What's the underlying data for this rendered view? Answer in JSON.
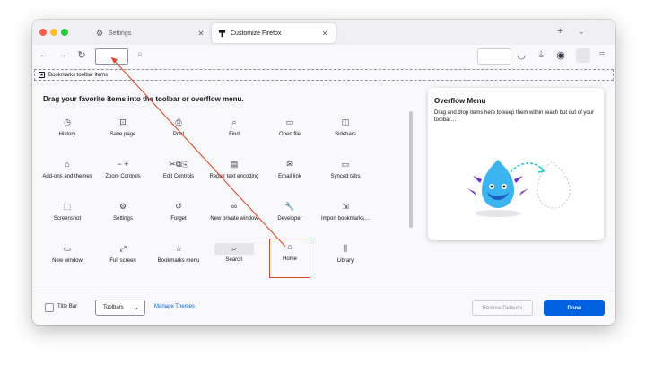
{
  "tabs": [
    {
      "title": "Settings",
      "icon": "gear-icon"
    },
    {
      "title": "Customize Firefox",
      "icon": "customize-icon"
    }
  ],
  "bookmarks_toolbar": {
    "label": "Bookmarks toolbar items"
  },
  "palette": {
    "title": "Drag your favorite items into the toolbar or overflow menu.",
    "items": [
      {
        "label": "History",
        "icon": "history-icon",
        "glyph": "◷"
      },
      {
        "label": "Save page",
        "icon": "save-page-icon",
        "glyph": "⊡"
      },
      {
        "label": "Print",
        "icon": "print-icon",
        "glyph": "⎙"
      },
      {
        "label": "Find",
        "icon": "find-icon",
        "glyph": "⌕"
      },
      {
        "label": "Open file",
        "icon": "open-file-icon",
        "glyph": "▭"
      },
      {
        "label": "Sidebars",
        "icon": "sidebars-icon",
        "glyph": "◫"
      },
      {
        "label": "Add-ons and themes",
        "icon": "addons-icon",
        "glyph": "⌂"
      },
      {
        "label": "Zoom Controls",
        "icon": "zoom-icon",
        "glyph": "−  +"
      },
      {
        "label": "Edit Controls",
        "icon": "edit-controls-icon",
        "glyph": "✂⧉⎘"
      },
      {
        "label": "Repair text encoding",
        "icon": "text-encoding-icon",
        "glyph": "▤"
      },
      {
        "label": "Email link",
        "icon": "email-icon",
        "glyph": "✉"
      },
      {
        "label": "Synced tabs",
        "icon": "synced-tabs-icon",
        "glyph": "▭"
      },
      {
        "label": "Screenshot",
        "icon": "screenshot-icon",
        "glyph": "⬚"
      },
      {
        "label": "Settings",
        "icon": "settings-icon",
        "glyph": "⚙"
      },
      {
        "label": "Forget",
        "icon": "forget-icon",
        "glyph": "↺"
      },
      {
        "label": "New private window",
        "icon": "private-window-icon",
        "glyph": "∞"
      },
      {
        "label": "Developer",
        "icon": "developer-icon",
        "glyph": "🔧"
      },
      {
        "label": "Import bookmarks…",
        "icon": "import-icon",
        "glyph": "⇲"
      },
      {
        "label": "New window",
        "icon": "new-window-icon",
        "glyph": "▭"
      },
      {
        "label": "Full screen",
        "icon": "fullscreen-icon",
        "glyph": "⤢"
      },
      {
        "label": "Bookmarks menu",
        "icon": "bookmarks-menu-icon",
        "glyph": "☆"
      },
      {
        "label": "Search",
        "icon": "search-icon",
        "glyph": "⌕"
      },
      {
        "label": "Home",
        "icon": "home-icon",
        "glyph": "⌂"
      },
      {
        "label": "Library",
        "icon": "library-icon",
        "glyph": "⫼"
      }
    ]
  },
  "overflow": {
    "title": "Overflow Menu",
    "description": "Drag and drop items here to keep them within reach but out of your toolbar…"
  },
  "footer": {
    "title_bar_label": "Title Bar",
    "toolbars_label": "Toolbars",
    "manage_themes": "Manage Themes",
    "restore_defaults": "Restore Defaults",
    "done": "Done"
  },
  "colors": {
    "accent": "#0061e0",
    "highlight": "#e04a2e"
  }
}
